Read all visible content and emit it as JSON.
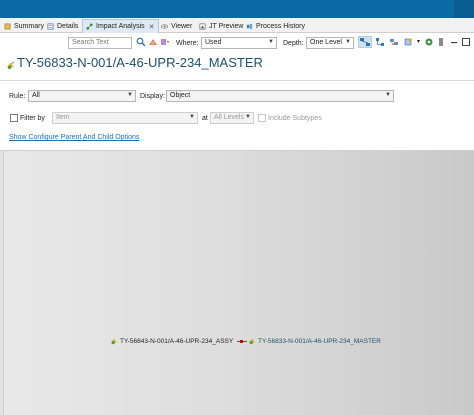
{
  "tabs": [
    {
      "label": "Summary",
      "icon": "summary-icon"
    },
    {
      "label": "Details",
      "icon": "details-icon"
    },
    {
      "label": "Impact Analysis",
      "icon": "impact-analysis-icon",
      "active": true,
      "close": "✕"
    },
    {
      "label": "Viewer",
      "icon": "viewer-icon"
    },
    {
      "label": "JT Preview",
      "icon": "jt-preview-icon"
    },
    {
      "label": "Process History",
      "icon": "process-history-icon"
    }
  ],
  "toolbar": {
    "search_placeholder": "Search Text",
    "where_label": "Where:",
    "where_value": "Used",
    "depth_label": "Depth:",
    "depth_value": "One Level"
  },
  "object_title": "TY-56833-N-001/A-46-UPR-234_MASTER",
  "filters": {
    "rule_label": "Rule:",
    "rule_value": "All",
    "display_label": "Display:",
    "display_value": "Object",
    "filter_by_label": "Filter by",
    "item_value": "Item",
    "at_label": "at",
    "levels_value": "All Levels",
    "include_subtypes_label": "Include Subtypes"
  },
  "link_text": "Show Configure Parent And Child Options",
  "graph": {
    "parent_node": "TY-56843-N-001/A-46-UPR-234_ASSY",
    "child_node": "TY-56833-N-001/A-46-UPR-234_MASTER"
  },
  "colors": {
    "topbar": "#0b6aa3",
    "title": "#1f4f6b",
    "link": "#1b6fb5",
    "connector_dot": "#cc0000"
  }
}
